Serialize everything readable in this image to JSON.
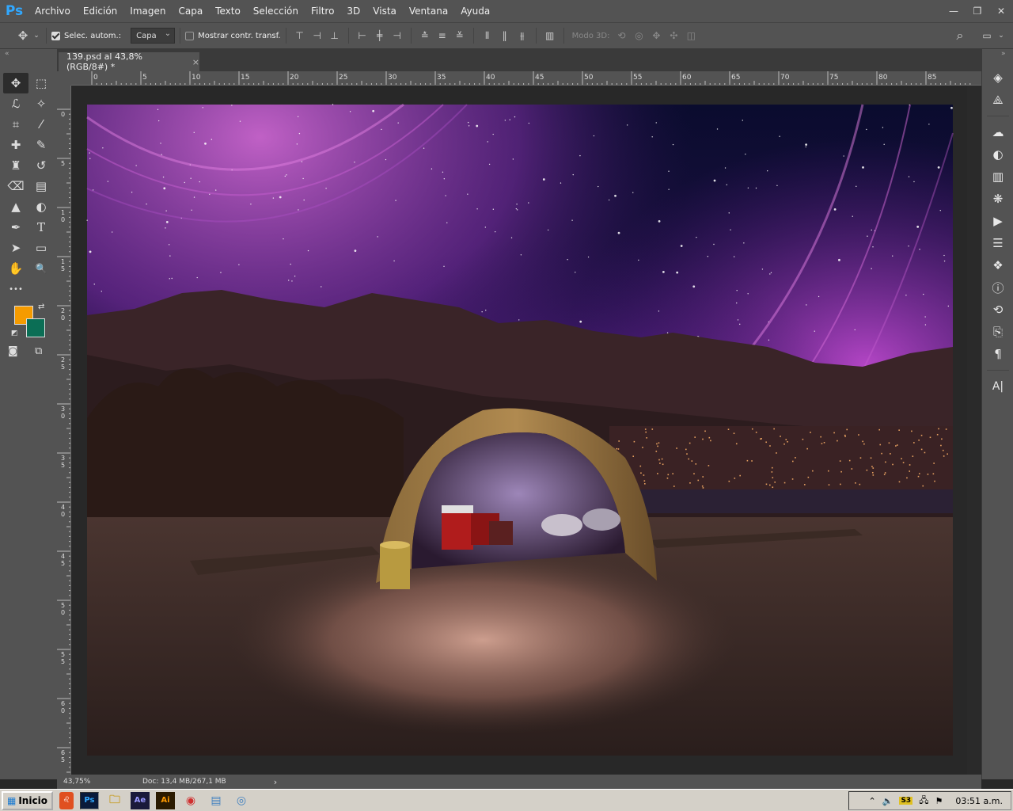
{
  "app": {
    "logo": "Ps"
  },
  "menu": [
    "Archivo",
    "Edición",
    "Imagen",
    "Capa",
    "Texto",
    "Selección",
    "Filtro",
    "3D",
    "Vista",
    "Ventana",
    "Ayuda"
  ],
  "window_controls": {
    "minimize": "—",
    "restore": "❐",
    "close": "✕"
  },
  "options": {
    "auto_select_label": "Selec. autom.:",
    "auto_select_checked": true,
    "layer_select_value": "Capa",
    "show_transform_label": "Mostrar contr. transf.",
    "show_transform_checked": false,
    "mode3d_label": "Modo 3D:"
  },
  "document_tab": {
    "title": "139.psd al 43,8% (RGB/8#) *",
    "close": "×"
  },
  "ruler": {
    "top": [
      "0",
      "5",
      "10",
      "15",
      "20",
      "25",
      "30",
      "35",
      "40",
      "45",
      "50",
      "55",
      "60",
      "65",
      "70",
      "75",
      "80",
      "85"
    ],
    "left": [
      "0",
      "5",
      "1 0",
      "1 5",
      "2 0",
      "2 5",
      "3 0",
      "3 5",
      "4 0",
      "4 5",
      "5 0",
      "5 5",
      "6 0",
      "6 5"
    ]
  },
  "colors": {
    "foreground": "#f59b00",
    "background": "#0b6e55",
    "app_bg": "#535353",
    "canvas_bg": "#282828"
  },
  "status": {
    "zoom": "43,75%",
    "doc_info": "Doc: 13,4 MB/267,1 MB",
    "arrow": "›"
  },
  "taskbar": {
    "start_label": "Inicio",
    "apps": [
      "brave",
      "photoshop",
      "file-explorer",
      "after-effects",
      "illustrator",
      "chrome",
      "notepad",
      "paint"
    ],
    "app_labels": {
      "ps": "Ps",
      "ae": "Ae",
      "ai": "Ai"
    },
    "tray_badge": "S3",
    "clock": "03:51 a.m."
  },
  "icons": {
    "move": "✥",
    "marquee": "⬚",
    "lasso": "ℒ",
    "magic": "✧",
    "crop": "⌗",
    "eyedropper": "⁄",
    "heal": "✚",
    "brush": "✎",
    "stamp": "♜",
    "history": "↺",
    "eraser": "⌫",
    "gradient": "▤",
    "blur": "▲",
    "dodge": "◐",
    "pen": "✒",
    "text": "T",
    "path": "➤",
    "shape": "▭",
    "hand": "✋",
    "zoom": "🔍",
    "more": "•••",
    "search": "⌕",
    "workspace": "▭"
  },
  "right_panel_icons": [
    "layers-icon",
    "paths-icon",
    "libraries-icon",
    "adjustments-icon",
    "histogram-icon",
    "navigator-icon",
    "actions-icon",
    "properties-icon",
    "color-icon",
    "info-icon",
    "history-icon",
    "channels-icon",
    "paragraph-icon",
    "character-icon"
  ],
  "right_panel_glyphs": [
    "◈",
    "⟁",
    "☁",
    "◐",
    "▥",
    "❋",
    "▶",
    "☰",
    "❖",
    "ⓘ",
    "⟲",
    "⎘",
    "¶",
    "A|"
  ]
}
